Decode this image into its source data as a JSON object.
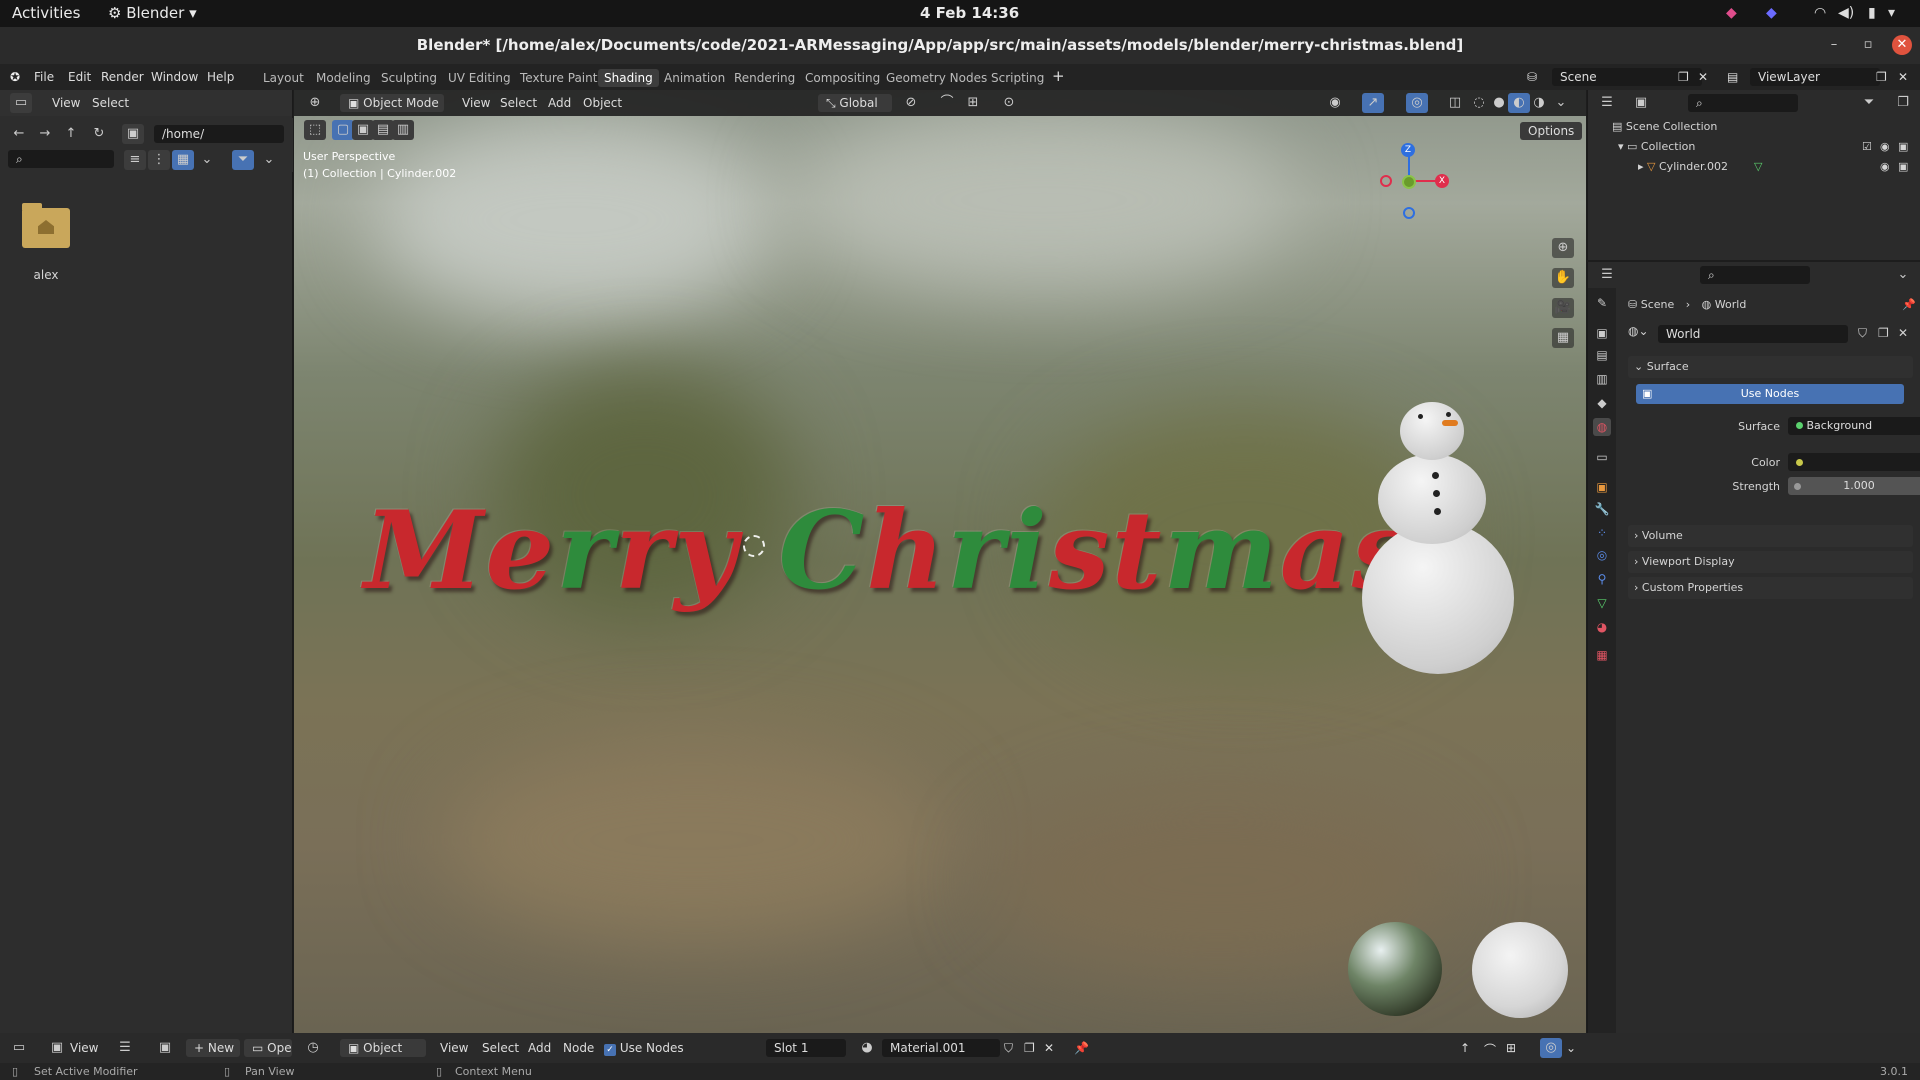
{
  "system_bar": {
    "activities": "Activities",
    "app_menu": "Blender",
    "clock": "4 Feb  14:36"
  },
  "window": {
    "title": "Blender* [/home/alex/Documents/code/2021-ARMessaging/App/app/src/main/assets/models/blender/merry-christmas.blend]"
  },
  "menu": [
    "File",
    "Edit",
    "Render",
    "Window",
    "Help"
  ],
  "workspaces": [
    "Layout",
    "Modeling",
    "Sculpting",
    "UV Editing",
    "Texture Paint",
    "Shading",
    "Animation",
    "Rendering",
    "Compositing",
    "Geometry Nodes",
    "Scripting"
  ],
  "active_workspace": "Shading",
  "scene": {
    "scene_label": "Scene",
    "viewlayer_label": "ViewLayer"
  },
  "file_browser": {
    "menu_view": "View",
    "menu_select": "Select",
    "path": "/home/",
    "folder_name": "alex"
  },
  "viewport": {
    "mode": "Object Mode",
    "menu_view": "View",
    "menu_select": "Select",
    "menu_add": "Add",
    "menu_object": "Object",
    "transform": "Global",
    "options": "Options",
    "overlay_line1": "User Perspective",
    "overlay_line2": "(1) Collection | Cylinder.002",
    "text_object": "Merry Christmas!",
    "gizmo_z": "Z",
    "gizmo_x": "X"
  },
  "outliner": {
    "root": "Scene Collection",
    "collection": "Collection",
    "object": "Cylinder.002"
  },
  "properties": {
    "breadcrumb_scene": "Scene",
    "breadcrumb_world": "World",
    "world_name": "World",
    "surface_section": "Surface",
    "use_nodes": "Use Nodes",
    "surface_label": "Surface",
    "surface_value": "Background",
    "color_label": "Color",
    "strength_label": "Strength",
    "strength_value": "1.000",
    "volume": "Volume",
    "viewport_display": "Viewport Display",
    "custom_props": "Custom Properties"
  },
  "node_editor_header": {
    "view": "View",
    "new": "New",
    "open": "Ope",
    "object": "Object",
    "menu_view": "View",
    "menu_select": "Select",
    "menu_add": "Add",
    "menu_node": "Node",
    "use_nodes": "Use Nodes",
    "slot": "Slot 1",
    "material": "Material.001"
  },
  "status_bar": {
    "left": "Set Active Modifier",
    "middle": "Pan View",
    "right": "Context Menu",
    "version": "3.0.1"
  },
  "colors": {
    "accent": "#4772b3",
    "red_text": "#c0272d",
    "green_text": "#2e8b3c"
  }
}
